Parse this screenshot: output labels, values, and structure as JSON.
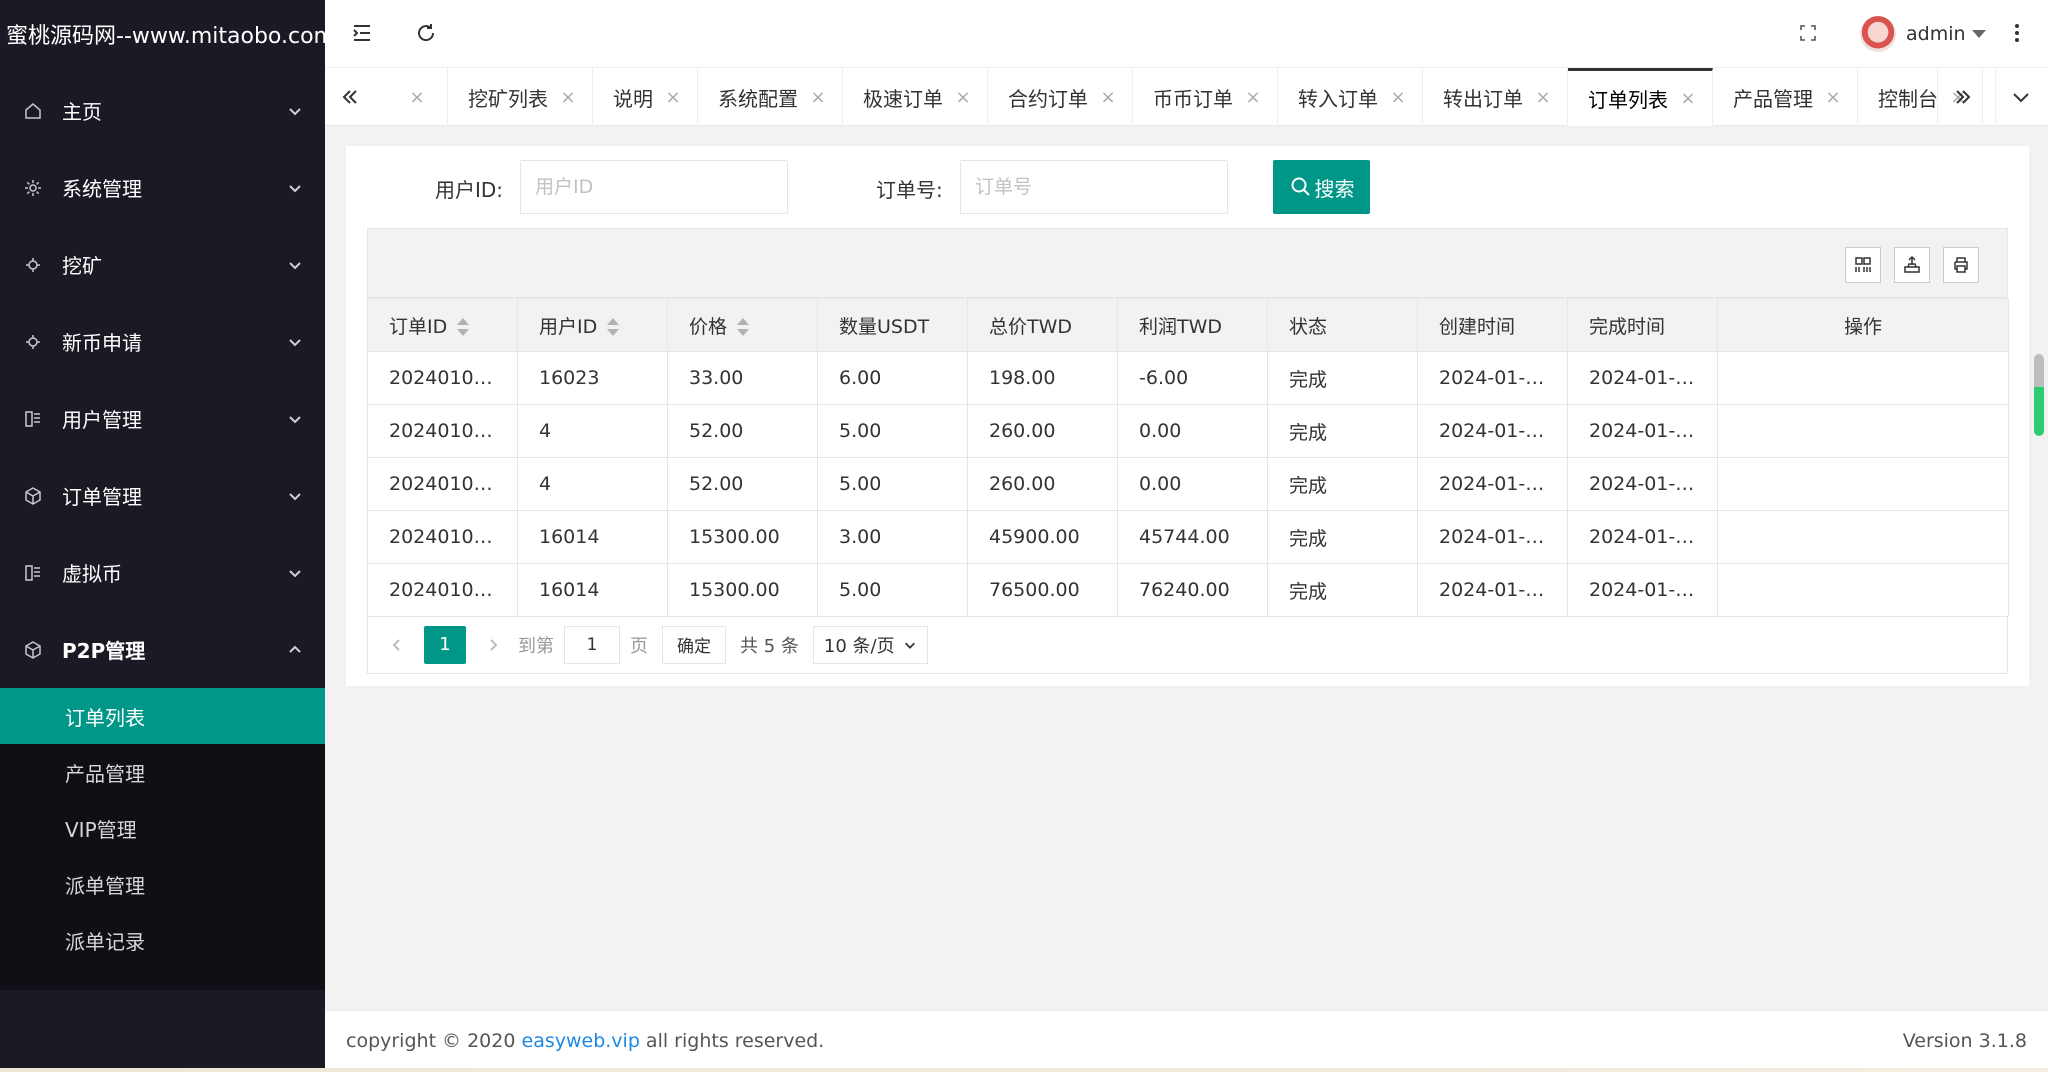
{
  "app": {
    "logo_text": "蜜桃源码网--www.mitaobo.com"
  },
  "sidebar": {
    "items": [
      {
        "label": "主页",
        "icon": "home-icon"
      },
      {
        "label": "系统管理",
        "icon": "gear-icon"
      },
      {
        "label": "挖矿",
        "icon": "mining-icon"
      },
      {
        "label": "新币申请",
        "icon": "coin-apply-icon"
      },
      {
        "label": "用户管理",
        "icon": "users-icon"
      },
      {
        "label": "订单管理",
        "icon": "box-icon"
      },
      {
        "label": "虚拟币",
        "icon": "virtual-coin-icon"
      },
      {
        "label": "P2P管理",
        "icon": "box-icon"
      }
    ],
    "submenu": [
      {
        "label": "订单列表",
        "active": true
      },
      {
        "label": "产品管理"
      },
      {
        "label": "VIP管理"
      },
      {
        "label": "派单管理"
      },
      {
        "label": "派单记录"
      }
    ]
  },
  "header": {
    "user_name": "admin"
  },
  "tabs": [
    {
      "label": ""
    },
    {
      "label": "挖矿列表"
    },
    {
      "label": "说明"
    },
    {
      "label": "系统配置"
    },
    {
      "label": "极速订单"
    },
    {
      "label": "合约订单"
    },
    {
      "label": "币币订单"
    },
    {
      "label": "转入订单"
    },
    {
      "label": "转出订单"
    },
    {
      "label": "订单列表",
      "active": true
    },
    {
      "label": "产品管理"
    },
    {
      "label": "控制台"
    }
  ],
  "search": {
    "user_id_label": "用户ID:",
    "user_id_placeholder": "用户ID",
    "order_no_label": "订单号:",
    "order_no_placeholder": "订单号",
    "button_label": "搜索"
  },
  "table": {
    "columns": [
      "订单ID",
      "用户ID",
      "价格",
      "数量USDT",
      "总价TWD",
      "利润TWD",
      "状态",
      "创建时间",
      "完成时间",
      "操作"
    ],
    "rows": [
      [
        "2024010…",
        "16023",
        "33.00",
        "6.00",
        "198.00",
        "-6.00",
        "完成",
        "2024-01-…",
        "2024-01-…",
        ""
      ],
      [
        "2024010…",
        "4",
        "52.00",
        "5.00",
        "260.00",
        "0.00",
        "完成",
        "2024-01-…",
        "2024-01-…",
        ""
      ],
      [
        "2024010…",
        "4",
        "52.00",
        "5.00",
        "260.00",
        "0.00",
        "完成",
        "2024-01-…",
        "2024-01-…",
        ""
      ],
      [
        "2024010…",
        "16014",
        "15300.00",
        "3.00",
        "45900.00",
        "45744.00",
        "完成",
        "2024-01-…",
        "2024-01-…",
        ""
      ],
      [
        "2024010…",
        "16014",
        "15300.00",
        "5.00",
        "76500.00",
        "76240.00",
        "完成",
        "2024-01-…",
        "2024-01-…",
        ""
      ]
    ]
  },
  "pager": {
    "current_page": "1",
    "goto_label": "到第",
    "goto_value": "1",
    "page_suffix": "页",
    "confirm_label": "确定",
    "total_label": "共 5 条",
    "page_size": "10 条/页"
  },
  "footer": {
    "copyright_prefix": "copyright © 2020 ",
    "link_text": "easyweb.vip",
    "copyright_suffix": " all rights reserved.",
    "version": "Version 3.1.8"
  },
  "colors": {
    "accent": "#009688",
    "sidebar_bg": "#191a23",
    "link": "#1e88e5"
  }
}
